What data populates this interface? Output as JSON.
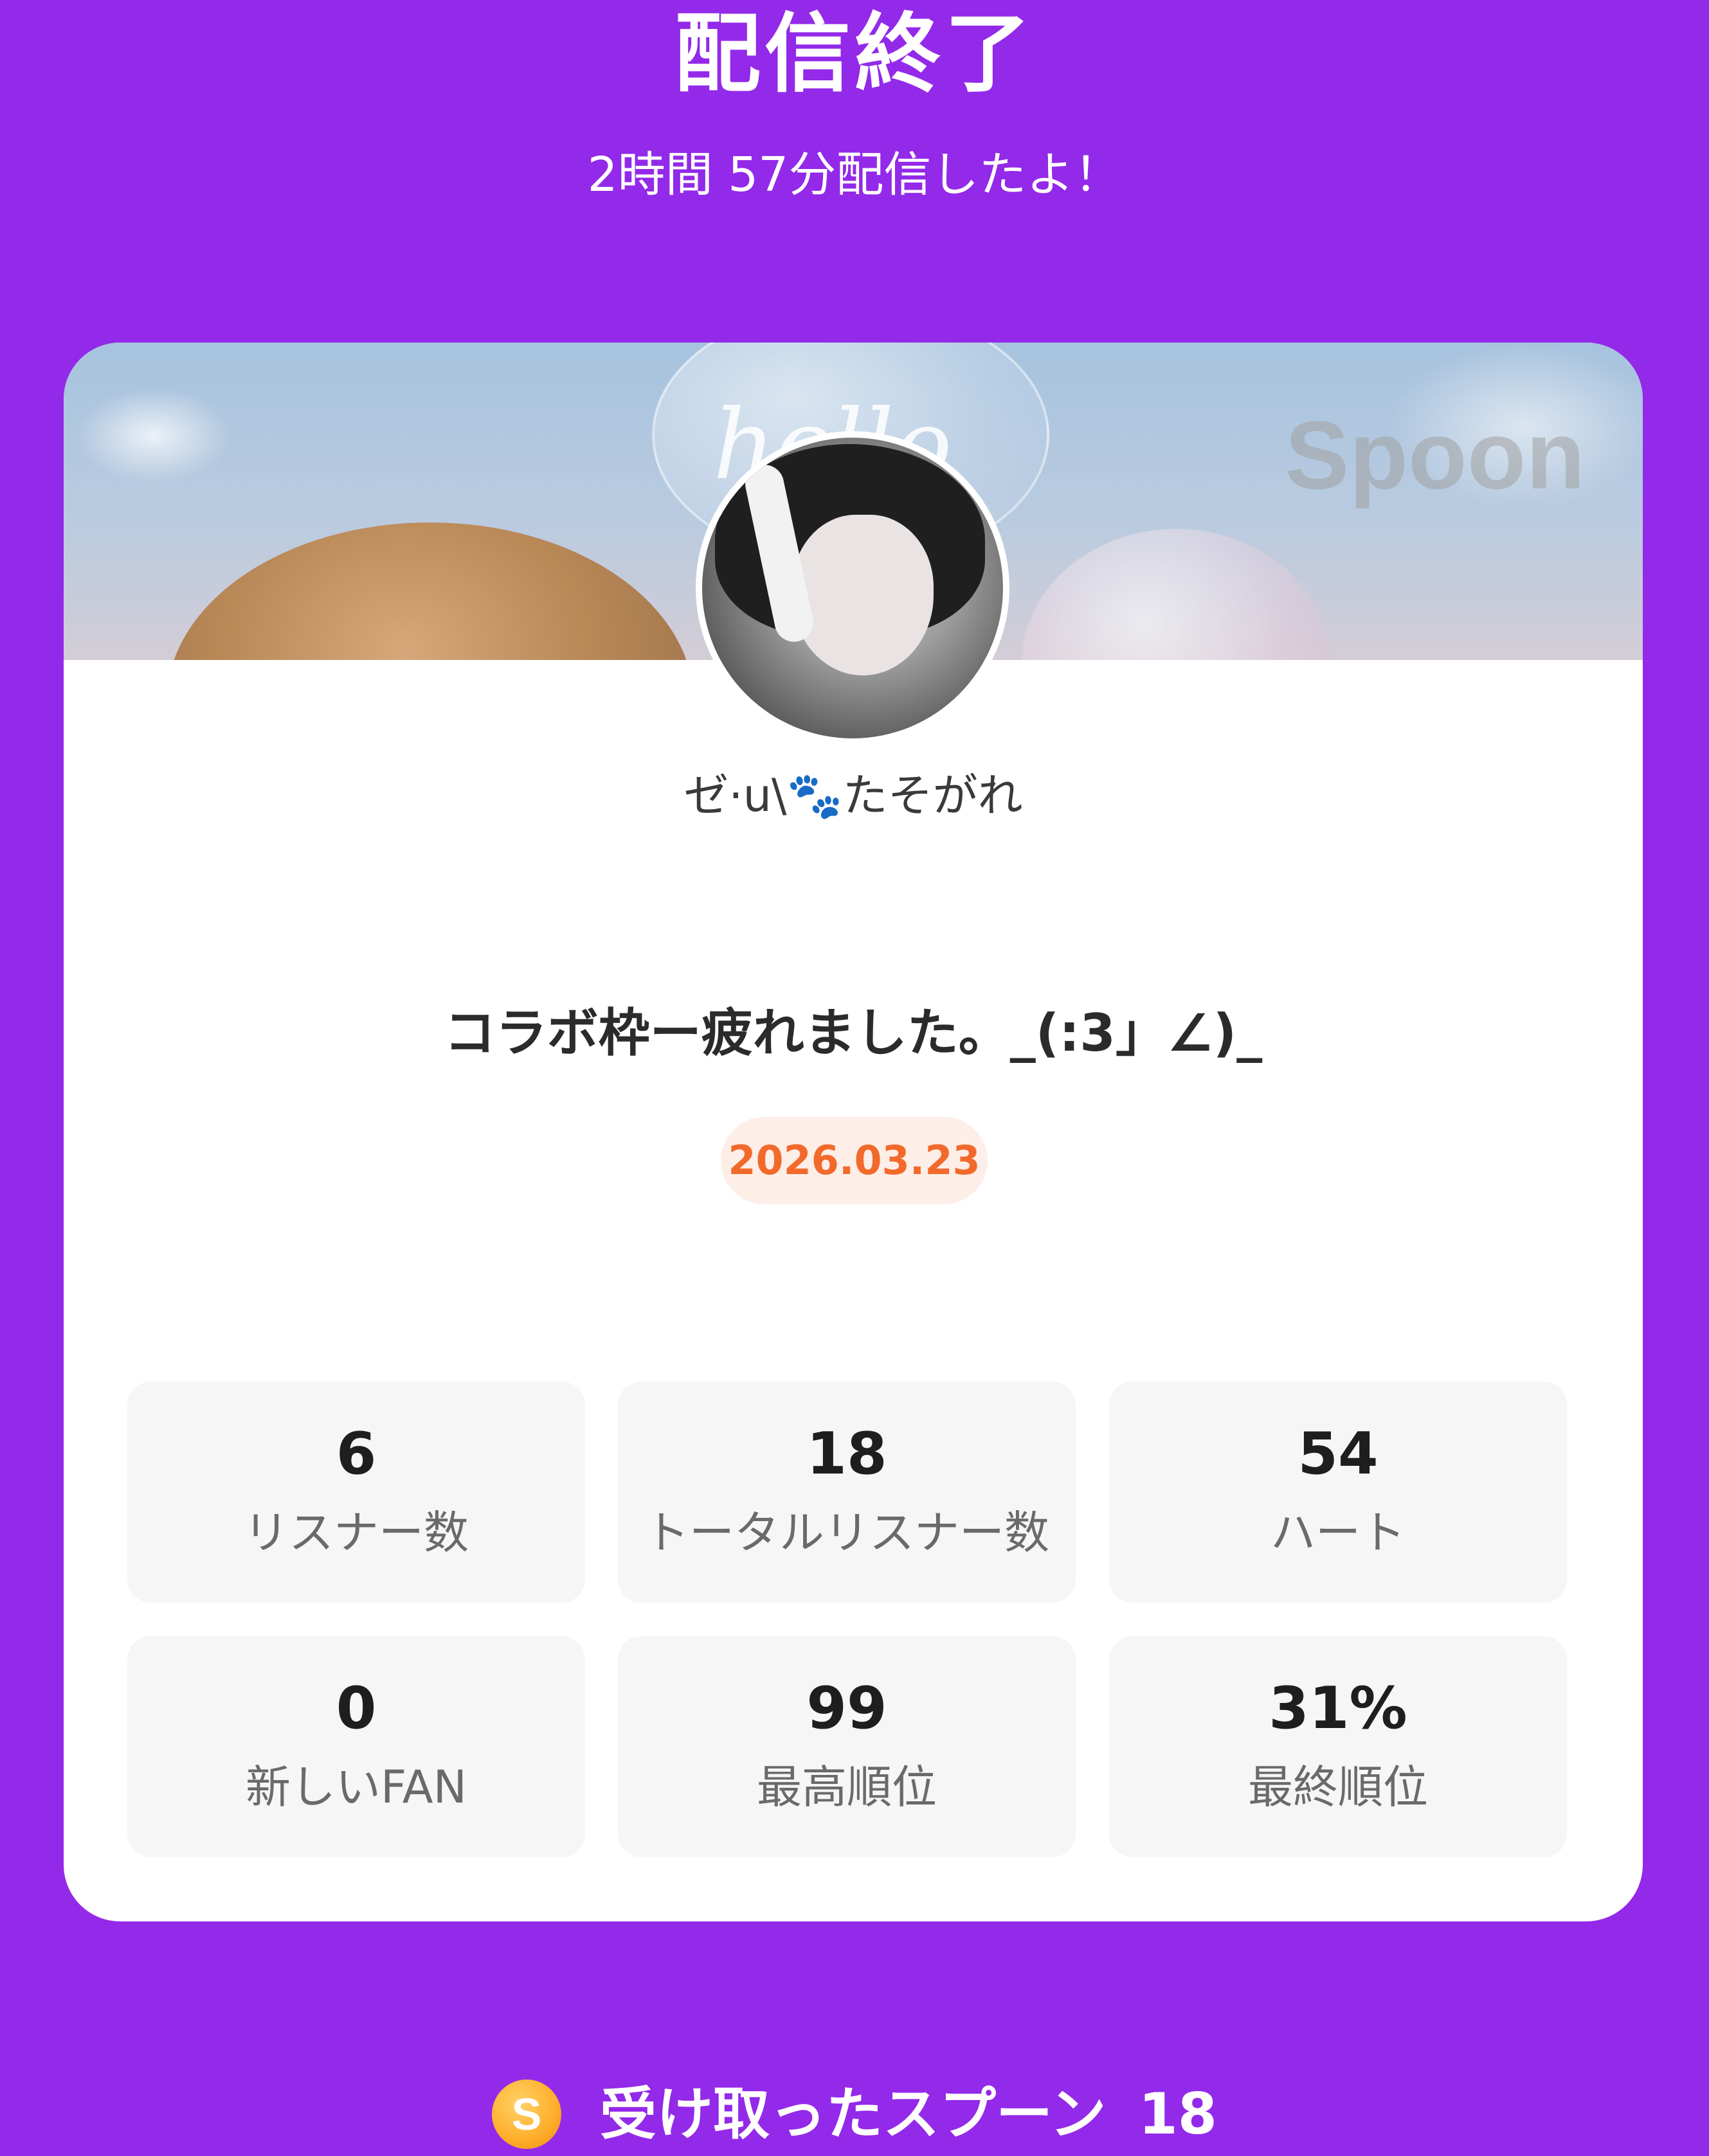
{
  "header": {
    "title": "配信終了",
    "duration_text": "2時間 57分配信したよ！"
  },
  "card": {
    "banner": {
      "bubble_text": "hello",
      "brand_text": "Spoon"
    },
    "username": "ゼ·u\\🐾たそがれ",
    "broadcast_title": "コラボ枠ー疲れました。_(:3」∠)_",
    "date": "2026.03.23",
    "stats": [
      {
        "value": "6",
        "label": "リスナー数"
      },
      {
        "value": "18",
        "label": "トータルリスナー数"
      },
      {
        "value": "54",
        "label": "ハート"
      },
      {
        "value": "0",
        "label": "新しいFAN"
      },
      {
        "value": "99",
        "label": "最高順位"
      },
      {
        "value": "31%",
        "label": "最終順位"
      }
    ]
  },
  "footer": {
    "spoon_icon_text": "S",
    "spoons_label": "受け取ったスプーン",
    "spoons_count": "18"
  },
  "colors": {
    "background": "#9329E9",
    "date_badge_bg": "#FDEEE8",
    "date_badge_text": "#F26A2B",
    "stat_tile_bg": "#F6F6F6"
  }
}
